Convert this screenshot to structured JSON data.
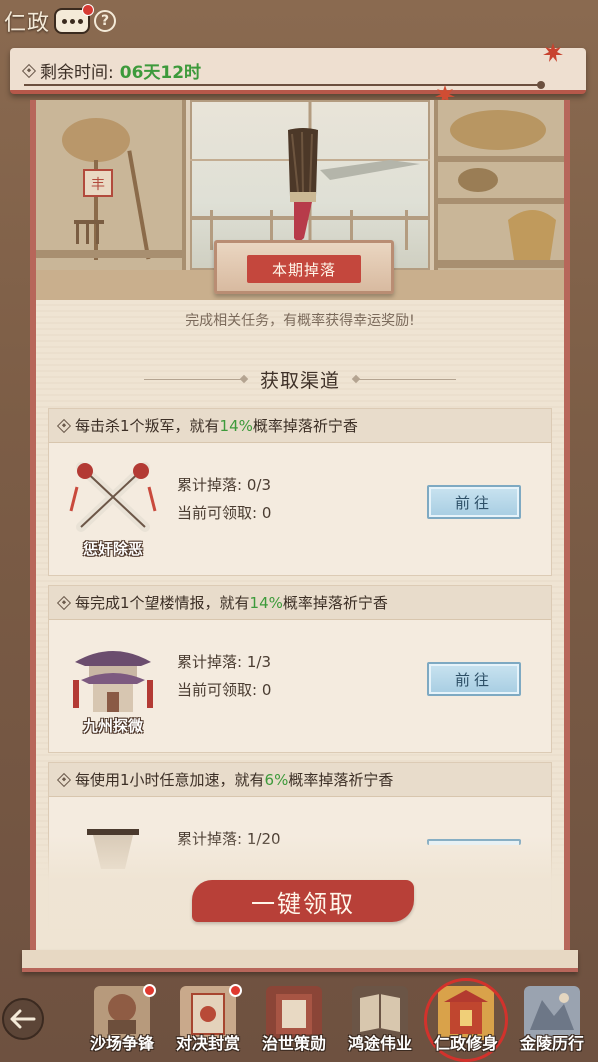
{
  "header": {
    "brand": "仁政",
    "help_symbol": "?"
  },
  "timer": {
    "label": "剩余时间:",
    "value": "06天12时"
  },
  "showcase": {
    "plate_label": "本期掉落",
    "hint": "完成相关任务，有概率获得幸运奖励!"
  },
  "section": {
    "title": "获取渠道"
  },
  "channels": [
    {
      "desc_prefix": "每击杀1个叛军，就有",
      "rate": "14%",
      "desc_suffix": "概率掉落祈宁香",
      "icon_name": "惩奸除恶",
      "cumulative_label": "累计掉落:",
      "cumulative_value": "0/3",
      "claimable_label": "当前可领取:",
      "claimable_value": "0",
      "goto_label": "前往"
    },
    {
      "desc_prefix": "每完成1个望楼情报，就有",
      "rate": "14%",
      "desc_suffix": "概率掉落祈宁香",
      "icon_name": "九州探微",
      "cumulative_label": "累计掉落:",
      "cumulative_value": "1/3",
      "claimable_label": "当前可领取:",
      "claimable_value": "0",
      "goto_label": "前往"
    },
    {
      "desc_prefix": "每使用1小时任意加速，就有",
      "rate": "6%",
      "desc_suffix": "概率掉落祈宁香",
      "icon_name": "",
      "cumulative_label": "累计掉落:",
      "cumulative_value": "1/20",
      "claimable_label": "",
      "claimable_value": "",
      "goto_label": ""
    }
  ],
  "claim_all": "一键领取",
  "nav": [
    {
      "label": "沙场争锋",
      "badge": true,
      "active": false,
      "icon": "battle-icon"
    },
    {
      "label": "对决封赏",
      "badge": true,
      "active": false,
      "icon": "duel-reward-icon"
    },
    {
      "label": "治世策勋",
      "badge": false,
      "active": false,
      "icon": "governance-icon"
    },
    {
      "label": "鸿途伟业",
      "badge": false,
      "active": false,
      "icon": "ledger-icon"
    },
    {
      "label": "仁政修身",
      "badge": false,
      "active": true,
      "icon": "shrine-icon"
    },
    {
      "label": "金陵历行",
      "badge": false,
      "active": false,
      "icon": "journey-icon"
    }
  ],
  "colors": {
    "accent_green": "#3d9a3b",
    "scroll_red": "#b7665a",
    "button_blue": "#a7cde2",
    "claim_red": "#b84038",
    "badge_red": "#e03a30"
  }
}
